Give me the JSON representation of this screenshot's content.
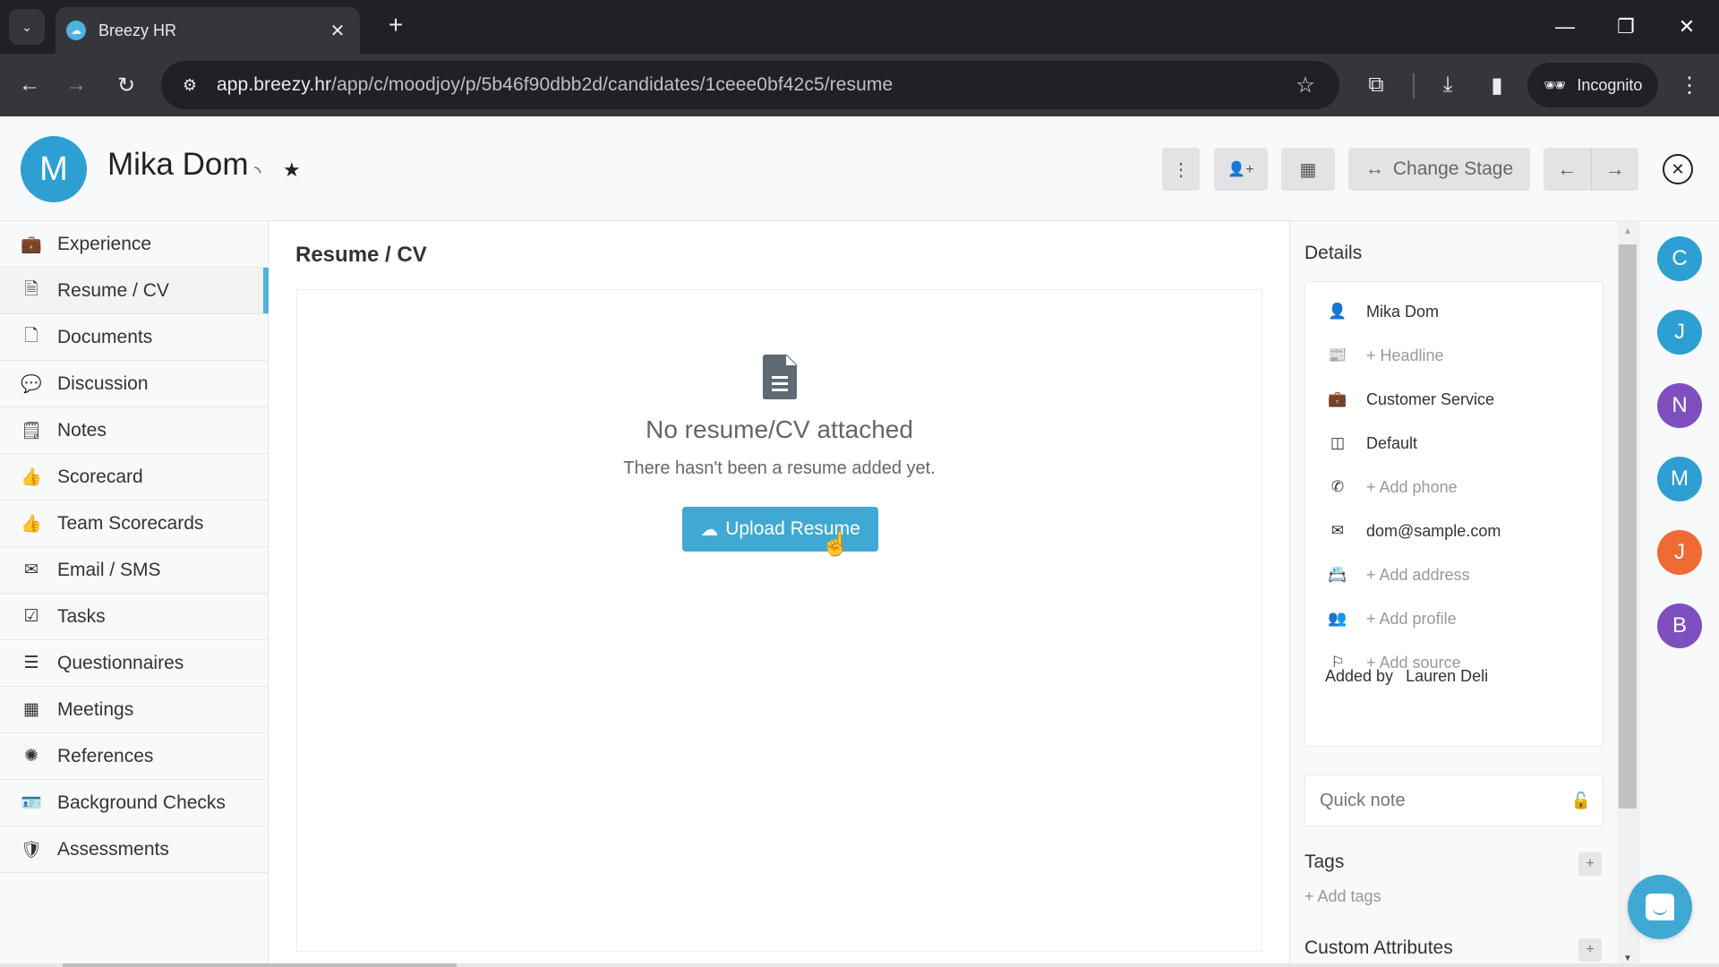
{
  "browser": {
    "tab_title": "Breezy HR",
    "url_host": "app.breezy.hr",
    "url_path": "/app/c/moodjoy/p/5b46f90dbb2d/candidates/1ceee0bf42c5/resume",
    "incognito_label": "Incognito",
    "icons": {
      "tab_dropdown": "⌄",
      "tab_close": "✕",
      "new_tab": "+",
      "minimize": "—",
      "restore": "❐",
      "close": "✕",
      "back": "←",
      "forward": "→",
      "reload": "↻",
      "site_info": "⚙",
      "bookmark": "☆",
      "extensions": "⧉",
      "download": "⤓",
      "side_panel": "▮",
      "incognito": "🕶",
      "menu": "⋮"
    }
  },
  "candidate": {
    "initial": "M",
    "name": "Mika Dom",
    "avatar_color": "#2e9fd2",
    "rss_icon": "◝",
    "star_icon": "★"
  },
  "header_actions": {
    "more_icon": "⋮",
    "add_user_icon": "👤+",
    "calendar_icon": "▦",
    "change_stage_icon": "↔",
    "change_stage_label": "Change Stage",
    "prev_icon": "←",
    "next_icon": "→",
    "close_icon": "✕"
  },
  "sidebar": {
    "active_index": 1,
    "accent": "#4fb3d9",
    "items": [
      {
        "label": "Experience",
        "icon": "💼"
      },
      {
        "label": "Resume / CV",
        "icon": "🗎"
      },
      {
        "label": "Documents",
        "icon": "🗋"
      },
      {
        "label": "Discussion",
        "icon": "💬"
      },
      {
        "label": "Notes",
        "icon": "🗒"
      },
      {
        "label": "Scorecard",
        "icon": "👍"
      },
      {
        "label": "Team Scorecards",
        "icon": "👍"
      },
      {
        "label": "Email / SMS",
        "icon": "✉"
      },
      {
        "label": "Tasks",
        "icon": "☑"
      },
      {
        "label": "Questionnaires",
        "icon": "☰"
      },
      {
        "label": "Meetings",
        "icon": "▦"
      },
      {
        "label": "References",
        "icon": "✺"
      },
      {
        "label": "Background Checks",
        "icon": "🪪"
      },
      {
        "label": "Assessments",
        "icon": "🛡"
      }
    ]
  },
  "main": {
    "title": "Resume / CV",
    "empty_title": "No resume/CV attached",
    "empty_subtitle": "There hasn't been a resume added yet.",
    "upload_icon": "☁",
    "upload_label": "Upload Resume",
    "upload_color": "#3fa9d4"
  },
  "details": {
    "title": "Details",
    "rows": [
      {
        "icon": "👤",
        "text": "Mika Dom",
        "placeholder": false
      },
      {
        "icon": "📰",
        "text": "+ Headline",
        "placeholder": true
      },
      {
        "icon": "💼",
        "text": "Customer Service",
        "placeholder": false
      },
      {
        "icon": "◫",
        "text": "Default",
        "placeholder": false
      },
      {
        "icon": "✆",
        "text": "+ Add phone",
        "placeholder": true
      },
      {
        "icon": "✉",
        "text": "dom@sample.com",
        "placeholder": false
      },
      {
        "icon": "📇",
        "text": "+ Add address",
        "placeholder": true
      },
      {
        "icon": "👥",
        "text": "+ Add profile",
        "placeholder": true
      },
      {
        "icon": "⚐",
        "text": "+ Add source",
        "placeholder": true
      }
    ],
    "added_by_label": "Added by",
    "added_by_name": "Lauren Deli",
    "quick_note_placeholder": "Quick note",
    "lock_icon": "🔓",
    "tags_title": "Tags",
    "add_tags": "+ Add tags",
    "custom_attributes_title": "Custom Attributes",
    "plus_icon": "+"
  },
  "team": [
    {
      "initial": "C",
      "color": "#2e9fd2"
    },
    {
      "initial": "J",
      "color": "#2e9fd2"
    },
    {
      "initial": "N",
      "color": "#7e4fbf"
    },
    {
      "initial": "M",
      "color": "#2e9fd2"
    },
    {
      "initial": "J",
      "color": "#f06a35"
    },
    {
      "initial": "B",
      "color": "#7e4fbf"
    }
  ],
  "scrollbar": {
    "up": "▲",
    "down": "▼"
  }
}
